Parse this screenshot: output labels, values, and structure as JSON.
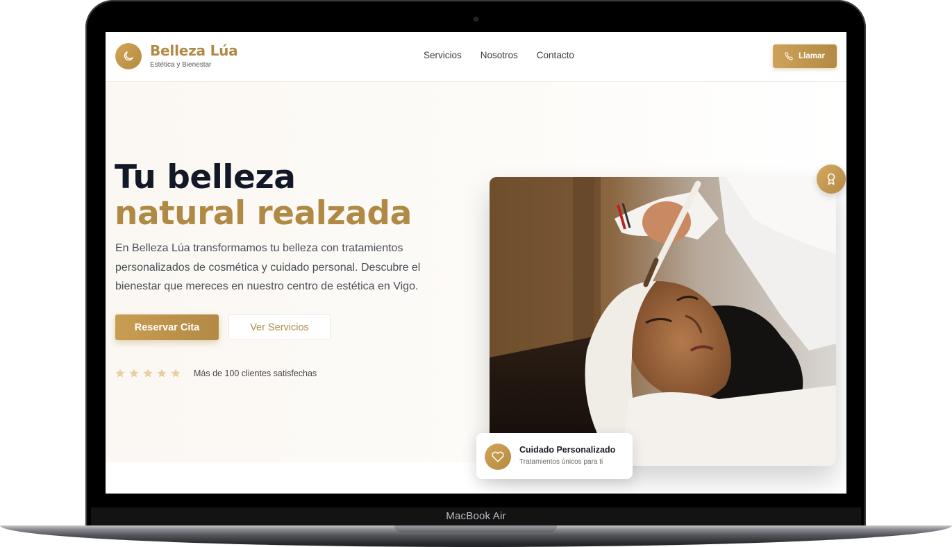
{
  "device": {
    "label": "MacBook Air"
  },
  "brand": {
    "name": "Belleza Lúa",
    "tagline": "Estética y Bienestar",
    "logo_icon": "moon-icon"
  },
  "nav": {
    "links": [
      "Servicios",
      "Nosotros",
      "Contacto"
    ]
  },
  "header": {
    "call_label": "Llamar",
    "call_icon": "phone-icon"
  },
  "hero": {
    "title_line1": "Tu belleza",
    "title_line2": "natural realzada",
    "description": "En Belleza Lúa transformamos tu belleza con tratamientos personalizados de cosmética y cuidado personal. Descubre el bienestar que mereces en nuestro centro de estética en Vigo.",
    "primary_button": "Reservar Cita",
    "secondary_button": "Ver Servicios",
    "rating_text": "Más de 100 clientes satisfechas",
    "stars": 5
  },
  "feature_card": {
    "title": "Cuidado Personalizado",
    "subtitle": "Tratamientos únicos para ti",
    "icon": "heart-icon"
  },
  "badge": {
    "icon": "award-icon"
  },
  "colors": {
    "accent": "#b08a45",
    "heading": "#121826",
    "star": "#e8cfa1"
  }
}
